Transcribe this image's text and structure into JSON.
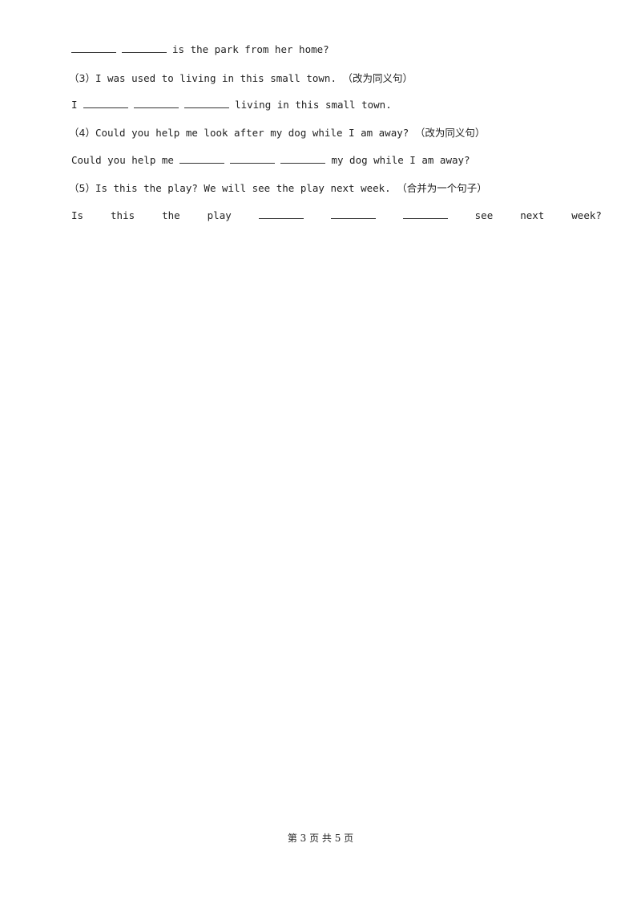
{
  "lines": {
    "l1_rest": "is the park from her home?",
    "q3_num": "（3）",
    "q3_text": "I was used to living in this small town.",
    "q3_note": "（改为同义句）",
    "a3_start": "I",
    "a3_rest": "living in this small town.",
    "q4_num": "（4）",
    "q4_text": "Could you help me look after my dog while I am away?",
    "q4_note": "（改为同义句）",
    "a4_start": "Could you help me",
    "a4_rest": "my dog while I am away?",
    "q5_num": "（5）",
    "q5_text": "Is this the play?  We will see the play next week.",
    "q5_note": "（合并为一个句子）",
    "a5_words": [
      "Is",
      "this",
      "the",
      "play",
      "see",
      "next",
      "week?"
    ]
  },
  "footer": {
    "text": "第 3 页 共 5 页"
  }
}
